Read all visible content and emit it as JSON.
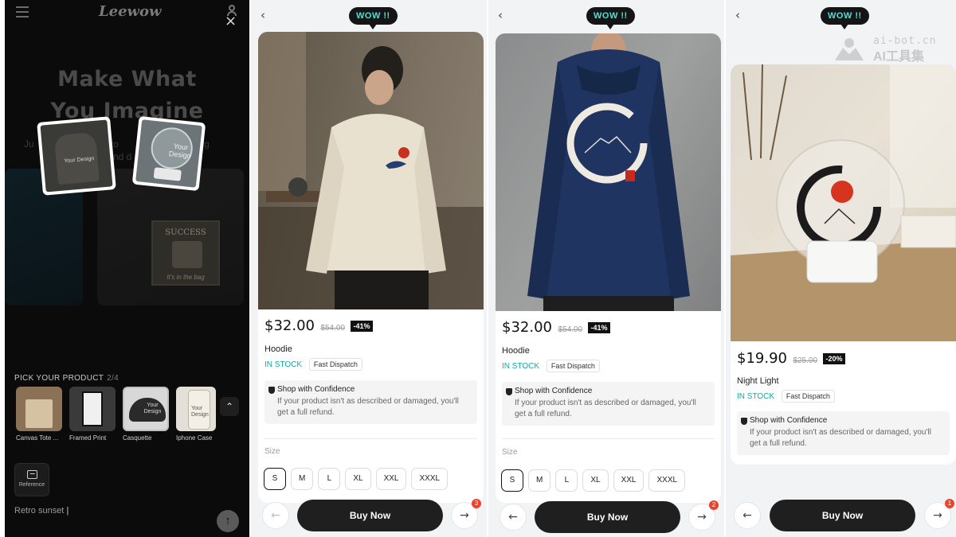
{
  "left_panel": {
    "logo": "Leewow",
    "close_symbol": "×",
    "hero_line1": "Make What",
    "hero_line2": "You Imagine",
    "subtitle_a": "Ju",
    "subtitle_b": "oto",
    "subtitle_c": "ning",
    "subtitle_d": "nd d",
    "tile_hoodie_label": "Your Design",
    "tile_light_label": "Your Design",
    "frame_title": "SUCCESS",
    "frame_caption": "It's in the bag",
    "pick_title": "PICK YOUR PRODUCT",
    "pick_count": "2/4",
    "products": [
      {
        "name": "Canvas Tote ..."
      },
      {
        "name": "Framed Print"
      },
      {
        "name": "Casquette",
        "label": "Your Design"
      },
      {
        "name": "Iphone Case",
        "label": "Your Design"
      }
    ],
    "reference_label": "Reference",
    "prompt_text": "Retro sunset",
    "prompt_caret": "|"
  },
  "panels": [
    {
      "wow": "WOW !!",
      "price": "$32.00",
      "old_price": "$54.00",
      "discount": "-41%",
      "name": "Hoodie",
      "stock": "IN STOCK",
      "dispatch": "Fast Dispatch",
      "confidence_title": "Shop with Confidence",
      "confidence_text": "If your product isn't as described or damaged, you'll get a full refund.",
      "size_label": "Size",
      "sizes": [
        "S",
        "M",
        "L",
        "XL",
        "XXL",
        "XXXL"
      ],
      "selected_size": "S",
      "buy_label": "Buy Now",
      "badge": "3"
    },
    {
      "wow": "WOW !!",
      "price": "$32.00",
      "old_price": "$54.00",
      "discount": "-41%",
      "name": "Hoodie",
      "stock": "IN STOCK",
      "dispatch": "Fast Dispatch",
      "confidence_title": "Shop with Confidence",
      "confidence_text": "If your product isn't as described or damaged, you'll get a full refund.",
      "size_label": "Size",
      "sizes": [
        "S",
        "M",
        "L",
        "XL",
        "XXL",
        "XXXL"
      ],
      "selected_size": "S",
      "buy_label": "Buy Now",
      "badge": "2"
    },
    {
      "wow": "WOW !!",
      "price": "$19.90",
      "old_price": "$25.00",
      "discount": "-20%",
      "name": "Night Light",
      "stock": "IN STOCK",
      "dispatch": "Fast Dispatch",
      "confidence_title": "Shop with Confidence",
      "confidence_text": "If your product isn't as described or damaged, you'll get a full refund.",
      "buy_label": "Buy Now",
      "badge": "1"
    }
  ],
  "watermark": {
    "line1": "ai-bot.cn",
    "line2": "AI工具集"
  },
  "colors": {
    "accent_teal": "#1aa6a0",
    "wow_text": "#4de0d8",
    "buy_button": "#1f1f1f",
    "badge": "#e8442f"
  }
}
